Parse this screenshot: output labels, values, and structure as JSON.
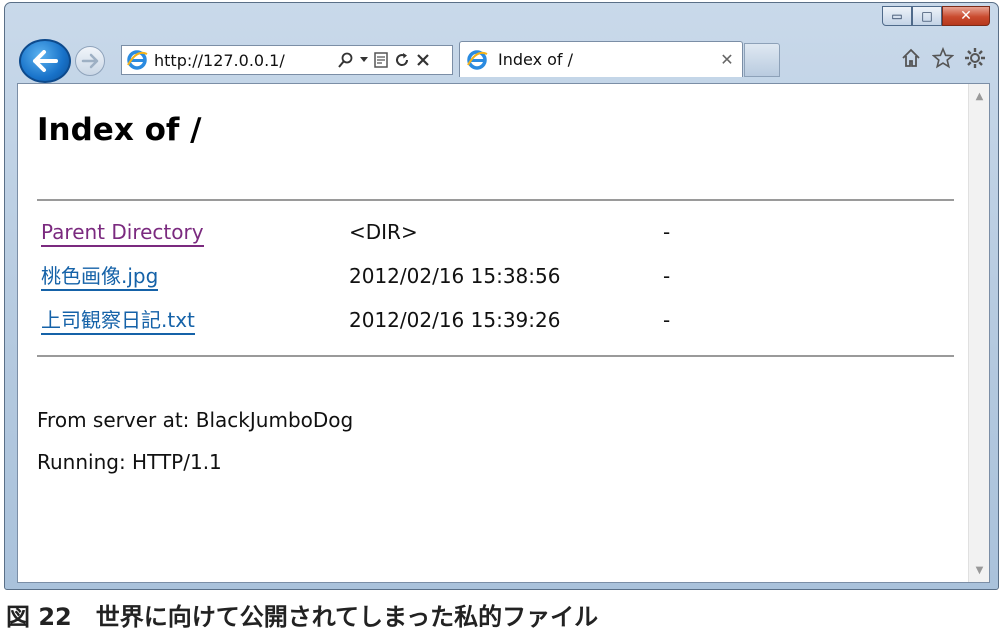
{
  "browser": {
    "address_url": "http://127.0.0.1/",
    "tab_title": "Index of /",
    "caption_buttons": {
      "minimize": "▭",
      "maximize": "□",
      "close": "✕"
    },
    "icons": [
      "back-icon",
      "forward-icon",
      "ie-logo-icon",
      "search-icon",
      "dropdown-icon",
      "compat-view-icon",
      "refresh-icon",
      "stop-icon",
      "tab-close-icon",
      "home-icon",
      "favorites-star-icon",
      "settings-gear-icon"
    ]
  },
  "page": {
    "heading": "Index of /",
    "entries": [
      {
        "name": "Parent Directory",
        "date": "<DIR>",
        "size": "-",
        "visited": true
      },
      {
        "name": "桃色画像.jpg",
        "date": "2012/02/16 15:38:56",
        "size": "-",
        "visited": false
      },
      {
        "name": "上司観察日記.txt",
        "date": "2012/02/16 15:39:26",
        "size": "-",
        "visited": false
      }
    ],
    "footer": {
      "server": "From server at: BlackJumboDog",
      "running": "Running: HTTP/1.1"
    }
  },
  "figure_caption": "図 22　世界に向けて公開されてしまった私的ファイル",
  "colors": {
    "visited_link": "#7b2a7f",
    "link": "#1562a8",
    "close_button": "#c94a2e",
    "back_button": "#1872c9"
  }
}
